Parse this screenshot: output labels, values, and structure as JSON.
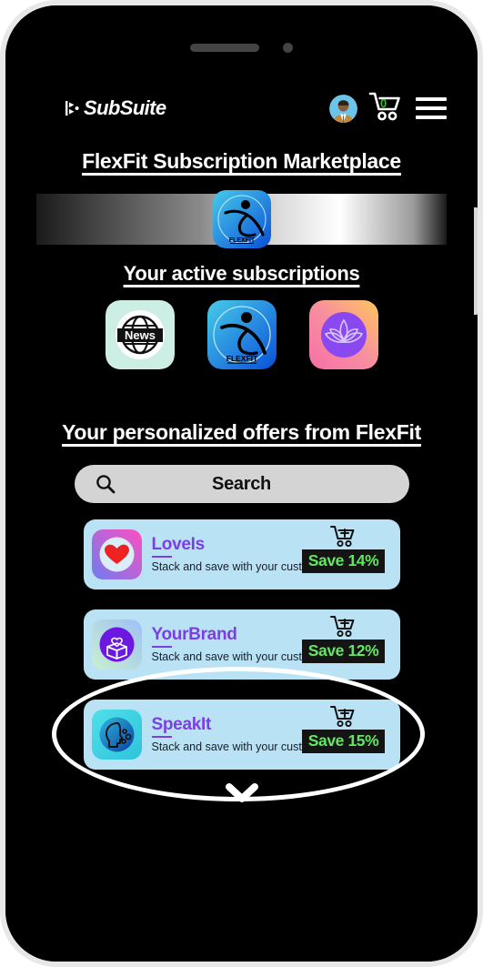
{
  "device": {
    "speaker_icon": "speaker-grille",
    "camera_icon": "front-camera",
    "side_button_icon": "side-button"
  },
  "header": {
    "brand_name": "SubSuite",
    "logo_mark_icon": "subsuite-logo-mark",
    "avatar_icon": "user-avatar",
    "cart_icon": "shopping-cart-icon",
    "cart_count": "0",
    "menu_icon": "hamburger-menu-icon"
  },
  "page": {
    "marketplace_title": "FlexFit Subscription Marketplace",
    "active_subs_heading": "Your active subscriptions",
    "offers_heading": "Your personalized offers from FlexFit"
  },
  "hero": {
    "icon": "flexfit-app-icon",
    "label": "FlexFit"
  },
  "active_subscriptions": [
    {
      "name": "News",
      "icon": "news-globe-icon",
      "label": "News"
    },
    {
      "name": "FlexFit",
      "icon": "flexfit-runner-icon",
      "label": "FlexFit"
    },
    {
      "name": "Lotus",
      "icon": "lotus-meditation-icon",
      "label": ""
    }
  ],
  "search": {
    "placeholder": "Search",
    "icon": "search-icon",
    "value": ""
  },
  "offers": [
    {
      "title": "LoveIs",
      "description": "Stack and save with your customized offer",
      "save_label": "Save 14%",
      "icon": "heart-icon",
      "add_icon": "add-to-cart-icon"
    },
    {
      "title": "YourBrand",
      "description": "Stack and save with your customized offer",
      "save_label": "Save 12%",
      "icon": "gift-box-heart-icon",
      "add_icon": "add-to-cart-icon"
    },
    {
      "title": "SpeakIt",
      "description": "Stack and save with your customized offer",
      "save_label": "Save 15%",
      "icon": "speaking-head-icon",
      "add_icon": "add-to-cart-icon"
    }
  ],
  "footer": {
    "scroll_down_icon": "chevron-down-icon"
  },
  "colors": {
    "screen_background": "#000000",
    "card_background": "#b9e2f5",
    "offer_title": "#7b3fe4",
    "save_text": "#63e763",
    "save_background": "#141414",
    "search_background": "#d4d4d4",
    "cart_badge": "#22cc22",
    "frame": "#e8e8e8"
  }
}
